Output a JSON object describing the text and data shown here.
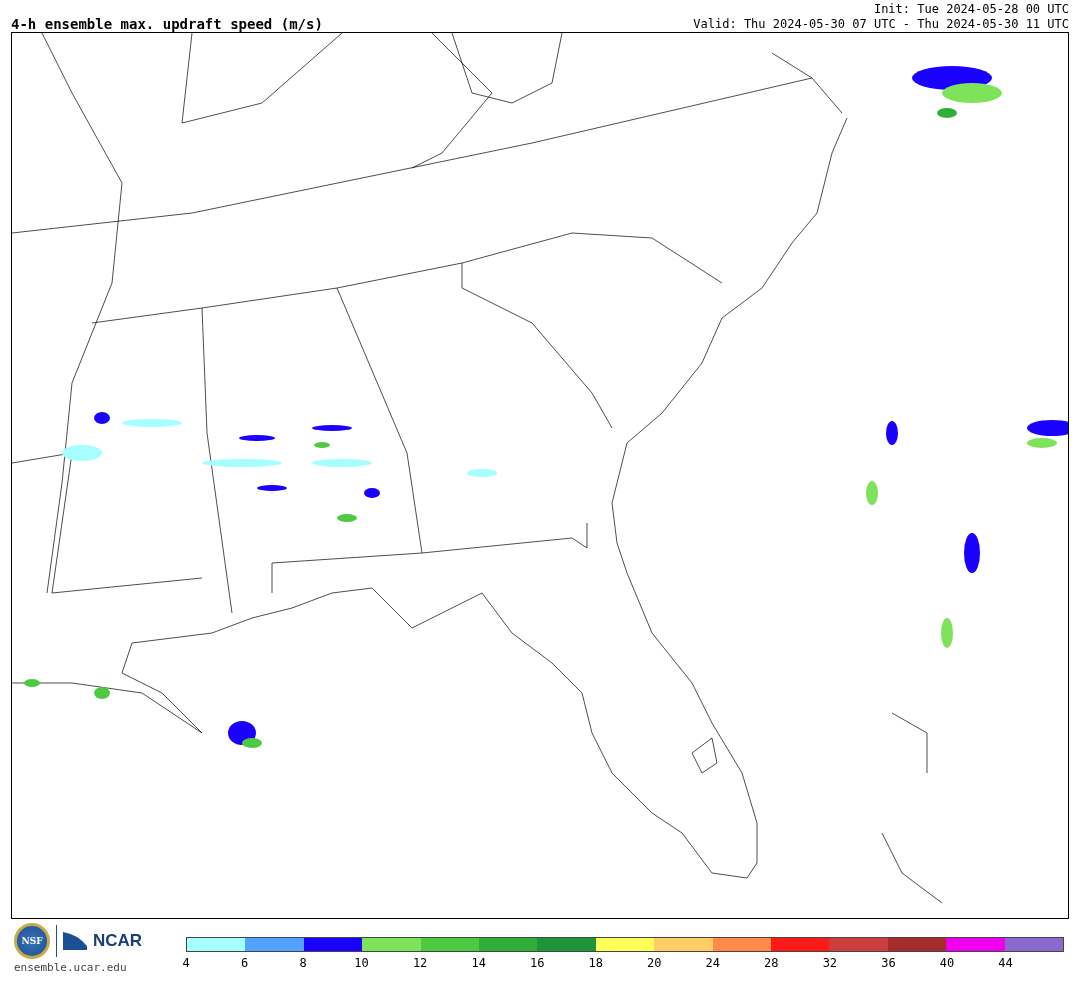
{
  "title": "4-h ensemble max. updraft speed (m/s)",
  "init": "Init: Tue 2024-05-28 00 UTC",
  "valid": "Valid: Thu 2024-05-30 07 UTC - Thu 2024-05-30 11 UTC",
  "logo": {
    "seal": "NSF",
    "name": "NCAR",
    "site": "ensemble.ucar.edu"
  },
  "colorbar": {
    "segments": [
      {
        "color": "#a6ffff"
      },
      {
        "color": "#52a3ff"
      },
      {
        "color": "#1a00ff"
      },
      {
        "color": "#7ee35a"
      },
      {
        "color": "#4ec942"
      },
      {
        "color": "#2fae3a"
      },
      {
        "color": "#1f943a"
      },
      {
        "color": "#ffff5a"
      },
      {
        "color": "#ffcf66"
      },
      {
        "color": "#ff8a4c"
      },
      {
        "color": "#ff1a1a"
      },
      {
        "color": "#cc3d3d"
      },
      {
        "color": "#a52c2c"
      },
      {
        "color": "#ee00ee"
      },
      {
        "color": "#8a68cc"
      }
    ],
    "ticks": [
      "4",
      "6",
      "8",
      "10",
      "12",
      "14",
      "16",
      "18",
      "20",
      "24",
      "28",
      "32",
      "36",
      "40",
      "44"
    ]
  }
}
